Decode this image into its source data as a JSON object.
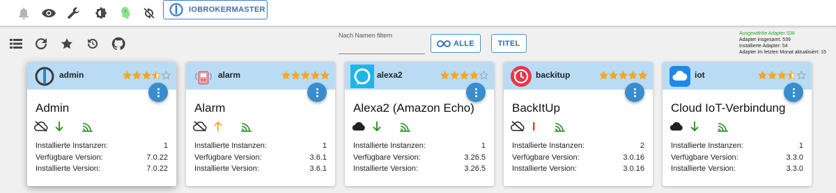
{
  "topbar": {
    "icons": [
      "bell-icon",
      "eye-icon",
      "wrench-icon",
      "theme-icon",
      "expert-mode-icon",
      "sync-icon"
    ],
    "host_label": "IOBROKERMASTER"
  },
  "toolbar": {
    "filter_label": "Nach Namen filtern",
    "filter_value": "",
    "btn_all": "ALLE",
    "btn_title": "TITEL"
  },
  "stats": {
    "selected": "Ausgewählte Adapter 538",
    "total": "Adapter insgesamt: 539",
    "installed": "Installierte Adapter: 54",
    "updated": "Adapter im letzten Monat aktualisiert: 15"
  },
  "labels": {
    "installed_instances": "Installierte Instanzen:",
    "available_version": "Verfügbare Version:",
    "installed_version": "Installierte Version:"
  },
  "colors": {
    "accent": "#3a8dcc",
    "header": "#b9dcf4",
    "star": "#f5a623",
    "arrow_down": "#1a8a1a",
    "arrow_up": "#f5a623",
    "signal": "#1a8a1a",
    "stats_green": "#2aa52a"
  },
  "cards": [
    {
      "name": "admin",
      "title": "Admin",
      "rating": 3.5,
      "cloud": "off",
      "status": "down",
      "instances": "1",
      "available": "7.0.22",
      "installed": "7.0.22"
    },
    {
      "name": "alarm",
      "title": "Alarm",
      "rating": 5,
      "cloud": "off",
      "status": "up",
      "instances": "1",
      "available": "3.6.1",
      "installed": "3.6.1"
    },
    {
      "name": "alexa2",
      "title": "Alexa2 (Amazon Echo)",
      "rating": 4,
      "cloud": "on",
      "status": "down",
      "instances": "1",
      "available": "3.26.5",
      "installed": "3.26.5"
    },
    {
      "name": "backitup",
      "title": "BackItUp",
      "rating": 5,
      "cloud": "off",
      "status": "bar",
      "instances": "2",
      "available": "3.0.16",
      "installed": "3.0.16"
    },
    {
      "name": "iot",
      "title": "Cloud IoT-Verbindung",
      "rating": 3.5,
      "cloud": "on",
      "status": "down",
      "instances": "1",
      "available": "3.3.0",
      "installed": "3.3.0"
    }
  ]
}
